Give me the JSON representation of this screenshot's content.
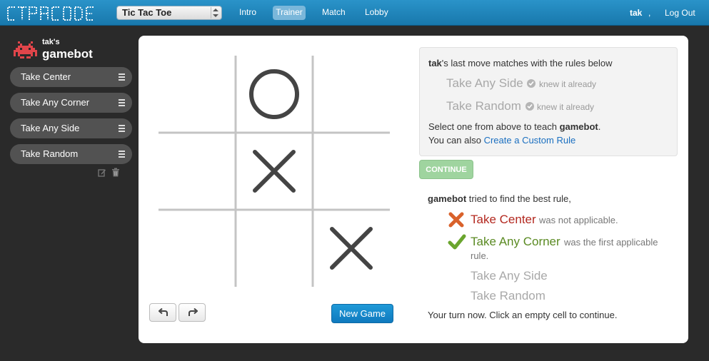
{
  "app": {
    "logo_text": "CTRPCODE",
    "username": "tak",
    "comma": ",",
    "logout": "Log Out"
  },
  "nav": {
    "game_select": "Tic Tac Toe",
    "links": [
      "Intro",
      "Trainer",
      "Match",
      "Lobby"
    ],
    "active": "Trainer"
  },
  "sidebar": {
    "owner": "tak's",
    "bot_name": "gamebot",
    "rules": [
      "Take Center",
      "Take Any Corner",
      "Take Any Side",
      "Take Random"
    ]
  },
  "board": {
    "cells": [
      "",
      "O",
      "",
      "",
      "X",
      "",
      "",
      "",
      "X"
    ]
  },
  "controls": {
    "new_game": "New Game"
  },
  "last_move": {
    "user": "tak",
    "text": "'s last move matches with the rules below",
    "matched_rules": [
      {
        "name": "Take Any Side",
        "note": "knew it already"
      },
      {
        "name": "Take Random",
        "note": "knew it already"
      }
    ],
    "select_prefix": "Select one from above to teach ",
    "select_bot": "gamebot",
    "select_suffix": ".",
    "custom_prefix": "You can also ",
    "custom_link": "Create a Custom Rule"
  },
  "continue_label": "CONTINUE",
  "result": {
    "bot": "gamebot",
    "intro": " tried to find the best rule,",
    "failed_rule": "Take Center",
    "failed_text": "was not applicable.",
    "applied_rule": "Take Any Corner",
    "applied_text_1": "was the first applicable",
    "applied_text_2": "rule.",
    "other_rules": [
      "Take Any Side",
      "Take Random"
    ],
    "turn_text": "Your turn now. Click an empty cell to continue."
  },
  "colors": {
    "topbar": "#1f88bf",
    "failed": "#b3281f",
    "applied": "#5a8a22",
    "primary_button": "#1a8ed0"
  }
}
